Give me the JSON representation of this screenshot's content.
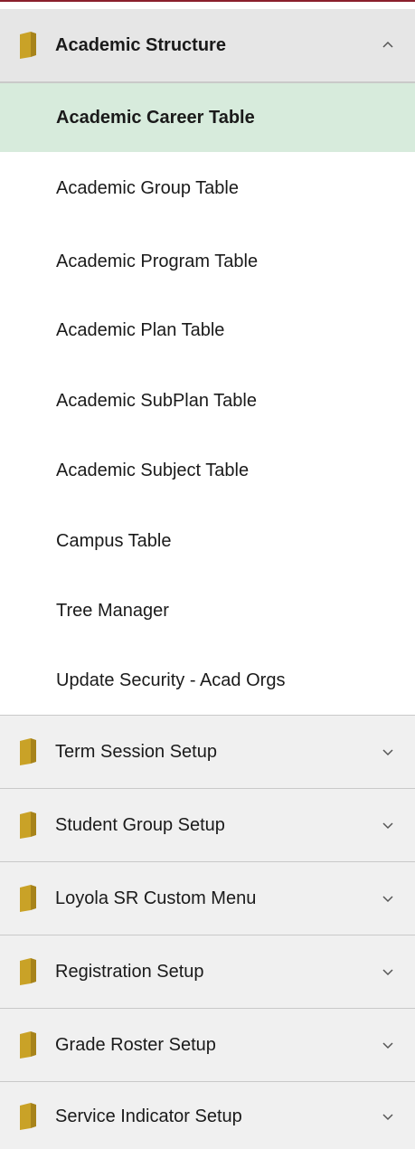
{
  "menu": {
    "accent_color": "#8a1f2c",
    "folder_color": "#c9a227",
    "selected_color": "#d7ebdc",
    "open_group": {
      "label": "Academic Structure",
      "icon": "folder-icon",
      "chevron": "chevron-up-icon",
      "items": [
        {
          "label": "Academic Career Table",
          "selected": true
        },
        {
          "label": "Academic Group Table"
        },
        {
          "label": "Academic Program Table"
        },
        {
          "label": "Academic Plan Table"
        },
        {
          "label": "Academic SubPlan Table"
        },
        {
          "label": "Academic Subject Table"
        },
        {
          "label": "Campus Table"
        },
        {
          "label": "Tree Manager"
        },
        {
          "label": "Update Security - Acad Orgs"
        }
      ]
    },
    "collapsed_groups": [
      {
        "label": "Term Session Setup",
        "chevron": "chevron-down-icon"
      },
      {
        "label": "Student Group Setup",
        "chevron": "chevron-down-icon"
      },
      {
        "label": "Loyola SR Custom Menu",
        "chevron": "chevron-down-icon"
      },
      {
        "label": "Registration Setup",
        "chevron": "chevron-down-icon"
      },
      {
        "label": "Grade Roster Setup",
        "chevron": "chevron-down-icon"
      },
      {
        "label": "Service Indicator Setup",
        "chevron": "chevron-down-icon"
      }
    ]
  }
}
